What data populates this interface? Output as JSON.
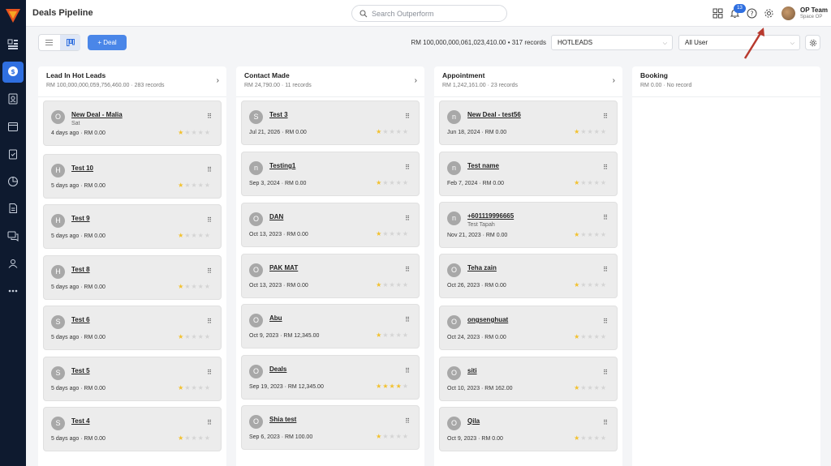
{
  "header": {
    "title": "Deals Pipeline",
    "search_placeholder": "Search Outperform",
    "notification_count": "13",
    "user_name": "OP Team",
    "user_sub": "Space OP"
  },
  "toolbar": {
    "add_deal_label": "Deal",
    "summary": "RM 100,000,000,061,023,410.00 • 317 records",
    "pipeline_select": "HOTLEADS",
    "user_select": "All User"
  },
  "columns": [
    {
      "title": "Lead In Hot Leads",
      "sub": "RM 100,000,000,059,756,460.00 · 283 records",
      "cards": [
        {
          "initial": "O",
          "name": "New Deal - Malia",
          "sub": "Sat",
          "meta": "4 days ago · RM 0.00",
          "stars": 1
        },
        {
          "initial": "H",
          "name": "Test 10",
          "sub": "",
          "meta": "5 days ago · RM 0.00",
          "stars": 1
        },
        {
          "initial": "H",
          "name": "Test 9",
          "sub": "",
          "meta": "5 days ago · RM 0.00",
          "stars": 1
        },
        {
          "initial": "H",
          "name": "Test 8",
          "sub": "",
          "meta": "5 days ago · RM 0.00",
          "stars": 1
        },
        {
          "initial": "S",
          "name": "Test 6",
          "sub": "",
          "meta": "5 days ago · RM 0.00",
          "stars": 1
        },
        {
          "initial": "S",
          "name": "Test 5",
          "sub": "",
          "meta": "5 days ago · RM 0.00",
          "stars": 1
        },
        {
          "initial": "S",
          "name": "Test 4",
          "sub": "",
          "meta": "5 days ago · RM 0.00",
          "stars": 1
        }
      ]
    },
    {
      "title": "Contact Made",
      "sub": "RM 24,790.00 · 11 records",
      "cards": [
        {
          "initial": "S",
          "name": "Test 3",
          "sub": "",
          "meta": "Jul 21, 2026 · RM 0.00",
          "stars": 1
        },
        {
          "initial": "n",
          "name": "Testing1",
          "sub": "",
          "meta": "Sep 3, 2024 · RM 0.00",
          "stars": 1
        },
        {
          "initial": "O",
          "name": "DAN",
          "sub": "",
          "meta": "Oct 13, 2023 · RM 0.00",
          "stars": 1
        },
        {
          "initial": "O",
          "name": "PAK MAT",
          "sub": "",
          "meta": "Oct 13, 2023 · RM 0.00",
          "stars": 1
        },
        {
          "initial": "O",
          "name": "Abu",
          "sub": "",
          "meta": "Oct 9, 2023 · RM 12,345.00",
          "stars": 1
        },
        {
          "initial": "O",
          "name": "Deals",
          "sub": "",
          "meta": "Sep 19, 2023 · RM 12,345.00",
          "stars": 4
        },
        {
          "initial": "O",
          "name": "Shia test",
          "sub": "",
          "meta": "Sep 6, 2023 · RM 100.00",
          "stars": 1
        }
      ]
    },
    {
      "title": "Appointment",
      "sub": "RM 1,242,161.00 · 23 records",
      "cards": [
        {
          "initial": "n",
          "name": "New Deal - test56",
          "sub": "",
          "meta": "Jun 18, 2024 · RM 0.00",
          "stars": 1
        },
        {
          "initial": "n",
          "name": "Test name",
          "sub": "",
          "meta": "Feb 7, 2024 · RM 0.00",
          "stars": 1
        },
        {
          "initial": "n",
          "name": "+601119996665",
          "sub": "Test Tapah",
          "meta": "Nov 21, 2023 · RM 0.00",
          "stars": 1
        },
        {
          "initial": "O",
          "name": "Teha zain",
          "sub": "",
          "meta": "Oct 26, 2023 · RM 0.00",
          "stars": 1
        },
        {
          "initial": "O",
          "name": "ongsenghuat",
          "sub": "",
          "meta": "Oct 24, 2023 · RM 0.00",
          "stars": 1
        },
        {
          "initial": "O",
          "name": "siti",
          "sub": "",
          "meta": "Oct 10, 2023 · RM 162.00",
          "stars": 1
        },
        {
          "initial": "O",
          "name": "Qila",
          "sub": "",
          "meta": "Oct 9, 2023 · RM 0.00",
          "stars": 1
        }
      ]
    },
    {
      "title": "Booking",
      "sub": "RM 0.00 · No record",
      "cards": []
    }
  ],
  "colors": {
    "sidebar": "#0e1a2f",
    "accent": "#2f6fe0",
    "star": "#f2c12e",
    "annotation_arrow": "#b83a2e"
  },
  "icons": [
    "logo-icon",
    "dashboard-icon",
    "deals-icon",
    "contacts-icon",
    "calendar-icon",
    "tasks-icon",
    "reports-icon",
    "documents-icon",
    "chat-icon",
    "team-icon",
    "more-icon",
    "search-icon",
    "apps-grid-icon",
    "bell-icon",
    "help-icon",
    "settings-gear-icon"
  ]
}
